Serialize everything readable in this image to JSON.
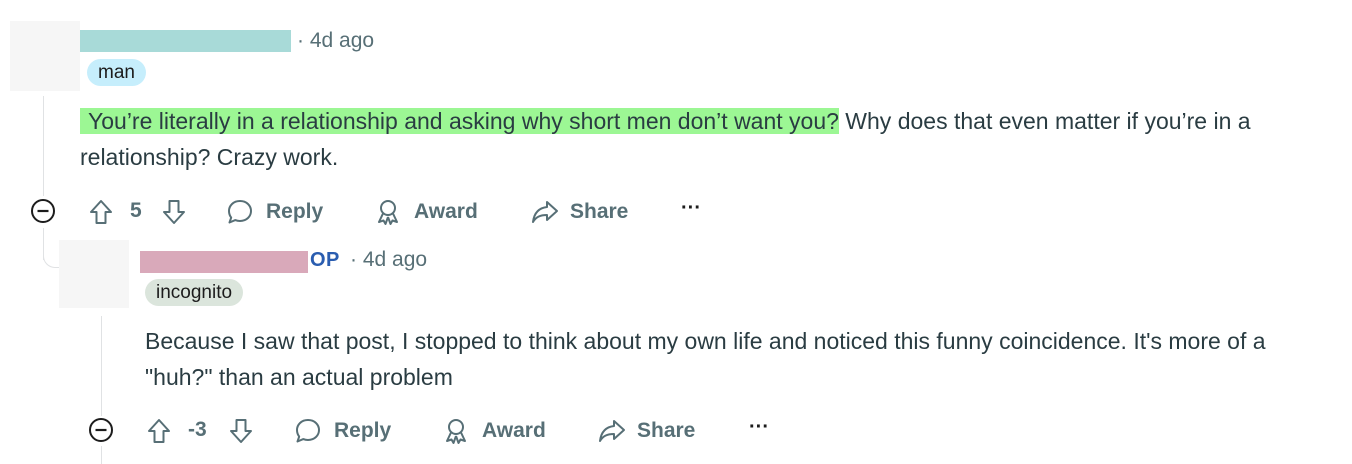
{
  "comment1": {
    "meta": "· 4d ago",
    "flair": "man",
    "highlighted_text": "You’re literally in a relationship and asking why short men don’t want you?",
    "text_after": " Why does that even matter if you’re in a relationship? Crazy work.",
    "actions": {
      "votes": "5",
      "reply": "Reply",
      "award": "Award",
      "share": "Share",
      "more": "···"
    }
  },
  "comment2": {
    "op_badge": "OP",
    "meta": "· 4d ago",
    "flair": "incognito",
    "text": "Because I saw that post, I stopped to think about my own life and noticed this funny coincidence. It's more of a \"huh?\" than an actual problem",
    "actions": {
      "votes": "-3",
      "reply": "Reply",
      "award": "Award",
      "share": "Share",
      "more": "···"
    }
  },
  "colors": {
    "highlight": "#9cf794",
    "redact_user1": "#a8dad8",
    "redact_user2": "#d9a9ba",
    "op": "#2a5db0",
    "flair_man": "#c6eefc",
    "flair_incognito": "#dbe5dc"
  }
}
